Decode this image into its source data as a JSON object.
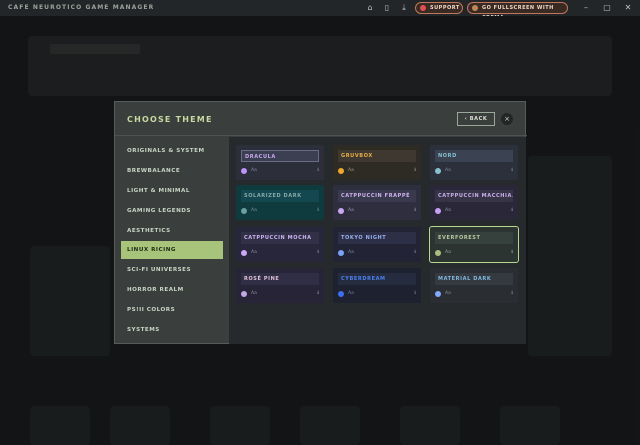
{
  "app": {
    "title": "CAFE NEUROTICO GAME MANAGER",
    "support_label": "SUPPORT",
    "fullscreen_label": "GO FULLSCREEN WITH CREMA"
  },
  "modal": {
    "title": "CHOOSE THEME",
    "back_label": "BACK",
    "close_label": "×"
  },
  "categories": [
    {
      "label": "ORIGINALS & SYSTEM"
    },
    {
      "label": "BREWBALANCE"
    },
    {
      "label": "LIGHT & MINIMAL"
    },
    {
      "label": "GAMING LEGENDS"
    },
    {
      "label": "AESTHETICS"
    },
    {
      "label": "LINUX RICING",
      "active": true
    },
    {
      "label": "SCI-FI UNIVERSES"
    },
    {
      "label": "HORROR REALM"
    },
    {
      "label": "PS!II COLORS"
    },
    {
      "label": "SYSTEMS"
    }
  ],
  "themes": [
    {
      "name": "DRACULA",
      "aa": "Aa",
      "right": "ℹ︎",
      "bg": "#2c2e3a",
      "bar": "#3c3f52",
      "text": "#c9a8f0",
      "dot": "#bd93f9",
      "muted": "#8a8ca8"
    },
    {
      "name": "GRUVBOX",
      "aa": "Aa",
      "right": "ℹ︎",
      "bg": "#2e2a24",
      "bar": "#3e3830",
      "text": "#e8b048",
      "dot": "#f0a830",
      "muted": "#a89880"
    },
    {
      "name": "NORD",
      "aa": "Aa",
      "right": "ℹ︎",
      "bg": "#2b303a",
      "bar": "#3b4252",
      "text": "#88c0d0",
      "dot": "#88c0d0",
      "muted": "#8890a0"
    },
    {
      "name": "SOLARIZED DARK",
      "aa": "Aa",
      "right": "ℹ︎",
      "bg": "#0f3a3e",
      "bar": "#134850",
      "text": "#8aa8a8",
      "dot": "#6aa0a0",
      "muted": "#7a9898"
    },
    {
      "name": "CATPPUCCIN FRAPPÉ",
      "aa": "Aa",
      "right": "ℹ︎",
      "bg": "#2e2e3e",
      "bar": "#3a3a4e",
      "text": "#d0b4f0",
      "dot": "#caa8f0",
      "muted": "#9a98b0"
    },
    {
      "name": "CATPPUCCIN MACCHIA...",
      "aa": "Aa",
      "right": "ℹ︎",
      "bg": "#2a2838",
      "bar": "#363446",
      "text": "#c8b0ec",
      "dot": "#c6a0f6",
      "muted": "#9490aa"
    },
    {
      "name": "CATPPUCCIN MOCHA",
      "aa": "Aa",
      "right": "ℹ︎",
      "bg": "#27263a",
      "bar": "#323046",
      "text": "#cbb4f4",
      "dot": "#cba6f7",
      "muted": "#908ea8"
    },
    {
      "name": "TOKYO NIGHT",
      "aa": "Aa",
      "right": "ℹ︎",
      "bg": "#222436",
      "bar": "#2c2f46",
      "text": "#9ab0f0",
      "dot": "#7aa2f7",
      "muted": "#8088a8"
    },
    {
      "name": "EVERFOREST",
      "aa": "Aa",
      "right": "ℹ︎",
      "bg": "#2c3432",
      "bar": "#36403c",
      "text": "#b8c8a0",
      "dot": "#a7c080",
      "muted": "#9aa898",
      "selected": true
    },
    {
      "name": "ROSÉ PINE",
      "aa": "Aa",
      "right": "ℹ︎",
      "bg": "#262436",
      "bar": "#302e44",
      "text": "#e0c0d8",
      "dot": "#c4a7e7",
      "muted": "#9890a8"
    },
    {
      "name": "CYBERDREAM",
      "aa": "Aa",
      "right": "ℹ︎",
      "bg": "#1e2230",
      "bar": "#262c40",
      "text": "#4a80f0",
      "dot": "#3a70f0",
      "muted": "#7080a0"
    },
    {
      "name": "MATERIAL DARK",
      "aa": "Aa",
      "right": "ℹ︎",
      "bg": "#2a2e32",
      "bar": "#343a40",
      "text": "#80b8e0",
      "dot": "#82aaff",
      "muted": "#8a9098"
    }
  ],
  "colors": {
    "accent": "#a8c47a",
    "modal_bg": "#3a3f3d",
    "grid_bg": "#262a2d"
  }
}
